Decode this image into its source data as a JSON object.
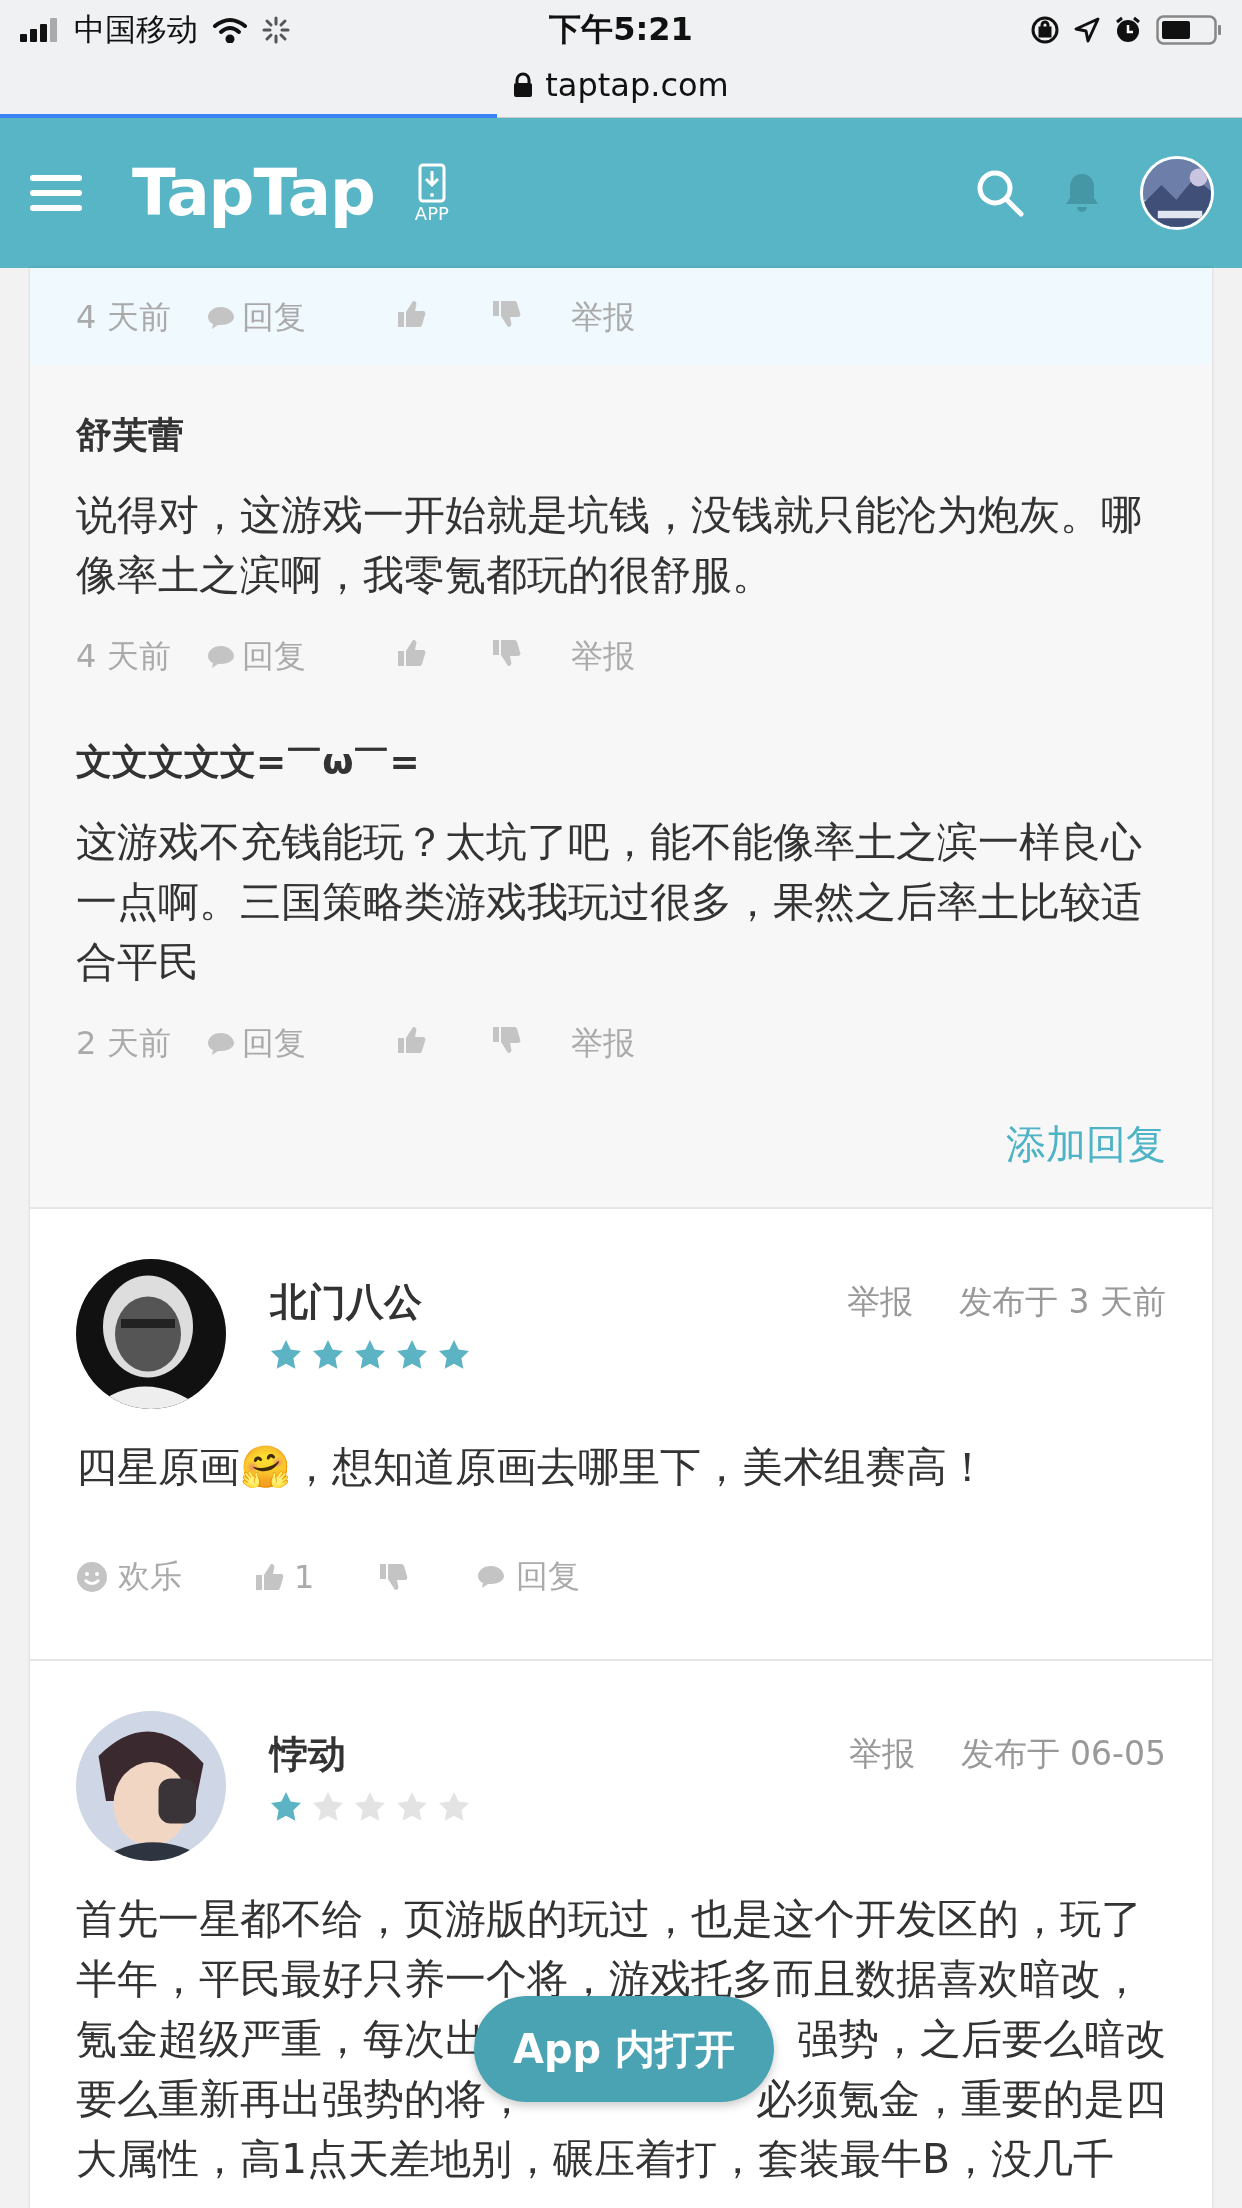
{
  "status_bar": {
    "carrier": "中国移动",
    "time": "下午5:21",
    "url": "taptap.com"
  },
  "page_load": {
    "level": 0.4
  },
  "header": {
    "logo": "TapTap",
    "app_label": "APP"
  },
  "comments": [
    {
      "highlighted": true,
      "time": "4 天前",
      "reply": "回复",
      "report": "举报"
    },
    {
      "highlighted": false,
      "name": "舒芙蕾",
      "body": "说得对，这游戏一开始就是坑钱，没钱就只能沦为炮灰。哪像率土之滨啊，我零氪都玩的很舒服。",
      "time": "4 天前",
      "reply": "回复",
      "report": "举报"
    },
    {
      "highlighted": false,
      "name": "文文文文文=￣ω￣=",
      "body": "这游戏不充钱能玩？太坑了吧，能不能像率土之滨一样良心一点啊。三国策略类游戏我玩过很多，果然之后率土比较适合平民",
      "time": "2 天前",
      "reply": "回复",
      "report": "举报"
    }
  ],
  "add_reply": "添加回复",
  "reviews": [
    {
      "name": "北门八公",
      "stars": 5,
      "report": "举报",
      "date": "发布于 3 天前",
      "body_lines": [
        [
          "四星原画🤗，想知道原画去哪里下，美术组赛高！"
        ]
      ],
      "actions": {
        "mood": "欢乐",
        "likes": "1",
        "reply": "回复"
      }
    },
    {
      "name": "悖动",
      "stars": 1,
      "report": "举报",
      "date": "发布于 06-05",
      "body_lines": [
        [
          "首先一星都不给，页游版的玩过，也是这个开发区的，玩了"
        ],
        [
          "半年，平民最好只养一个将，游戏托多而且数据喜欢暗改，"
        ],
        [
          "氪金超级严重，每次出",
          "强势，之后要么暗改"
        ],
        [
          "要么重新再出强势的将，",
          "必须氪金，重要的是四"
        ],
        [
          "大属性，高1点天差地别，碾压着打，套装最牛B，没几千"
        ]
      ]
    }
  ],
  "open_in_app": "App 内打开"
}
